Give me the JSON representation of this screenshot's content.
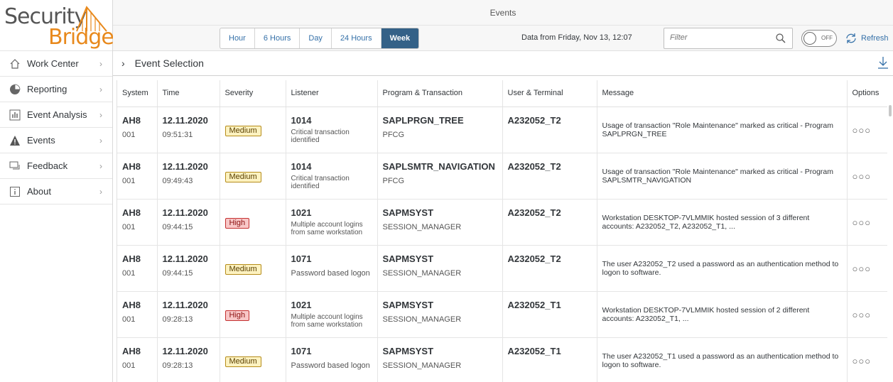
{
  "logo": {
    "word1": "Security",
    "word2": "Bridge"
  },
  "sidebar": {
    "items": [
      {
        "label": "Work Center",
        "icon": "home-icon"
      },
      {
        "label": "Reporting",
        "icon": "pie-chart-icon"
      },
      {
        "label": "Event Analysis",
        "icon": "bar-chart-icon"
      },
      {
        "label": "Events",
        "icon": "warning-icon"
      },
      {
        "label": "Feedback",
        "icon": "feedback-icon"
      },
      {
        "label": "About",
        "icon": "info-icon"
      }
    ]
  },
  "header": {
    "title": "Events"
  },
  "toolbar": {
    "ranges": [
      "Hour",
      "6 Hours",
      "Day",
      "24 Hours",
      "Week"
    ],
    "active_range": "Week",
    "data_from": "Data from Friday, Nov 13, 12:07",
    "filter_placeholder": "Filter",
    "toggle_label": "OFF",
    "refresh_label": "Refresh"
  },
  "section": {
    "title": "Event Selection"
  },
  "table": {
    "columns": [
      "System",
      "Time",
      "Severity",
      "Listener",
      "Program & Transaction",
      "User & Terminal",
      "Message",
      "Options"
    ],
    "rows": [
      {
        "system": "AH8",
        "client": "001",
        "date": "12.11.2020",
        "time": "09:51:31",
        "severity": "Medium",
        "listener_id": "1014",
        "listener_desc": "Critical transaction identified",
        "program": "SAPLPRGN_TREE",
        "transaction": "PFCG",
        "user": "A232052_T2",
        "message": "Usage of transaction \"Role Maintenance\" marked as critical - Program SAPLPRGN_TREE"
      },
      {
        "system": "AH8",
        "client": "001",
        "date": "12.11.2020",
        "time": "09:49:43",
        "severity": "Medium",
        "listener_id": "1014",
        "listener_desc": "Critical transaction identified",
        "program": "SAPLSMTR_NAVIGATION",
        "transaction": "PFCG",
        "user": "A232052_T2",
        "message": "Usage of transaction \"Role Maintenance\" marked as critical - Program SAPLSMTR_NAVIGATION"
      },
      {
        "system": "AH8",
        "client": "001",
        "date": "12.11.2020",
        "time": "09:44:15",
        "severity": "High",
        "listener_id": "1021",
        "listener_desc": "Multiple account logins from same workstation",
        "program": "SAPMSYST",
        "transaction": "SESSION_MANAGER",
        "user": "A232052_T2",
        "message": "Workstation DESKTOP-7VLMMIK hosted session of 3 different accounts: A232052_T2, A232052_T1, ..."
      },
      {
        "system": "AH8",
        "client": "001",
        "date": "12.11.2020",
        "time": "09:44:15",
        "severity": "Medium",
        "listener_id": "1071",
        "listener_desc": "Password based logon",
        "program": "SAPMSYST",
        "transaction": "SESSION_MANAGER",
        "user": "A232052_T2",
        "message": "The user A232052_T2 used a password as an authentication method to logon to software."
      },
      {
        "system": "AH8",
        "client": "001",
        "date": "12.11.2020",
        "time": "09:28:13",
        "severity": "High",
        "listener_id": "1021",
        "listener_desc": "Multiple account logins from same workstation",
        "program": "SAPMSYST",
        "transaction": "SESSION_MANAGER",
        "user": "A232052_T1",
        "message": "Workstation DESKTOP-7VLMMIK hosted session of 2 different accounts: A232052_T1, ..."
      },
      {
        "system": "AH8",
        "client": "001",
        "date": "12.11.2020",
        "time": "09:28:13",
        "severity": "Medium",
        "listener_id": "1071",
        "listener_desc": "Password based logon",
        "program": "SAPMSYST",
        "transaction": "SESSION_MANAGER",
        "user": "A232052_T1",
        "message": "The user A232052_T1 used a password as an authentication method to logon to software."
      }
    ]
  },
  "colors": {
    "accent": "#346187",
    "logo_orange": "#e8891c",
    "medium": "#fdf2c0",
    "high": "#f8c7c7"
  }
}
